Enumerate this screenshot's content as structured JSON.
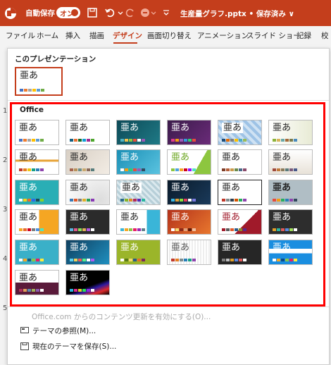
{
  "titlebar": {
    "autosave_label": "自動保存",
    "toggle_state": "オン",
    "document_title": "生産量グラフ.pptx • 保存済み ∨",
    "bg_color": "#c43e1c"
  },
  "ribbon": {
    "tabs": [
      "ファイル",
      "ホーム",
      "挿入",
      "描画",
      "デザイン",
      "画面切り替え",
      "アニメーション",
      "スライド ショー",
      "記録",
      "校"
    ],
    "active": "デザイン"
  },
  "slide_numbers": [
    "1",
    "2",
    "3",
    "4",
    "5"
  ],
  "gallery": {
    "section_presentation": "このプレゼンテーション",
    "section_office": "Office",
    "thumb_text": "亜あ",
    "menu": {
      "enable_updates": "Office.com からのコンテンツ更新を有効にする(O)...",
      "browse_themes": "テーマの参照(M)...",
      "save_theme": "現在のテーマを保存(S)..."
    }
  }
}
